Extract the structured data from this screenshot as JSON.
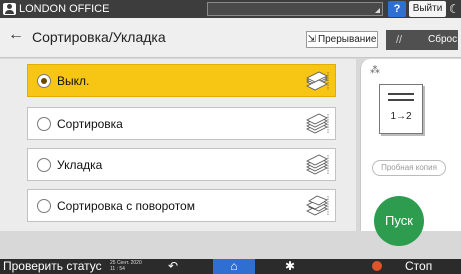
{
  "sysbar": {
    "user_label": "LONDON OFFICE",
    "help_label": "?",
    "logout_label": "Выйти",
    "moon_icon": "moon-icon"
  },
  "header": {
    "back_icon": "←",
    "title": "Сортировка/Укладка",
    "interrupt_label": "Прерывание",
    "reset_label": "Сброс"
  },
  "options": [
    {
      "label": "Выкл.",
      "selected": true
    },
    {
      "label": "Сортировка",
      "selected": false
    },
    {
      "label": "Укладка",
      "selected": false
    },
    {
      "label": "Сортировка с поворотом",
      "selected": false
    }
  ],
  "right_panel": {
    "preview_text": "1→2",
    "sample_copy_label": "Пробная копия",
    "start_label": "Пуск"
  },
  "bottombar": {
    "status_label": "Проверить статус",
    "date": "25 Сент. 2020",
    "time": "11 : 54",
    "stop_label": "Стоп"
  },
  "colors": {
    "selected_option": "#f7c614",
    "start_button": "#2e9c4f",
    "home_button": "#2f6fd1",
    "stop_icon": "#e0532b"
  }
}
